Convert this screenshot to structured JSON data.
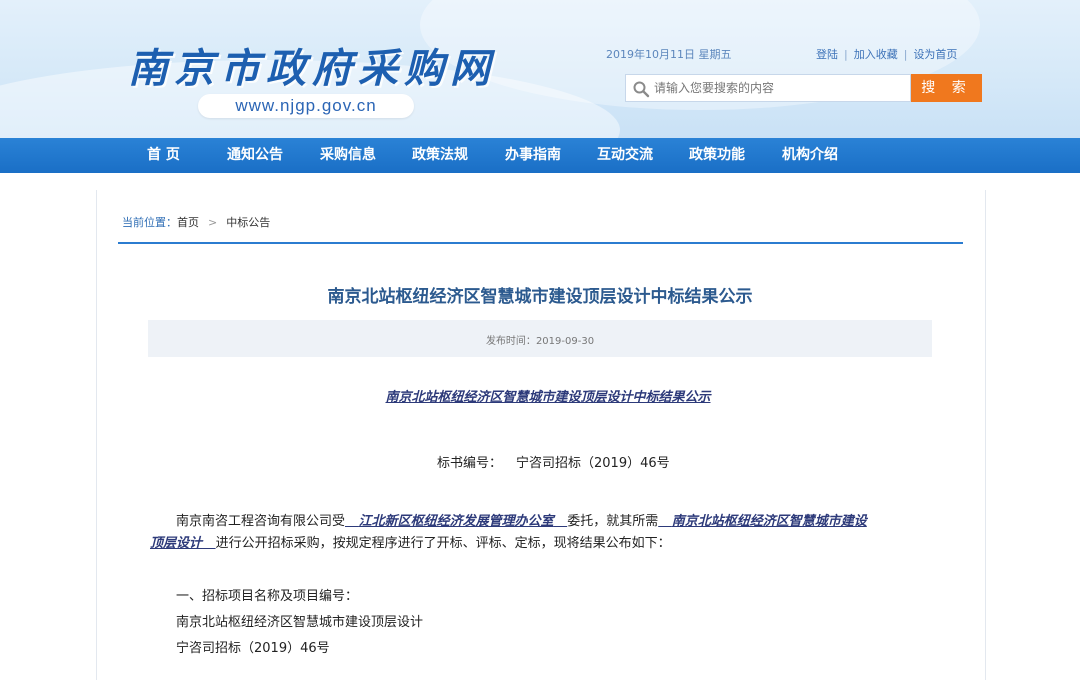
{
  "header": {
    "site_title": "南京市政府采购网",
    "site_url": "www.njgp.gov.cn",
    "date": "2019年10月11日 星期五",
    "links": [
      "登陆",
      "加入收藏",
      "设为首页"
    ],
    "search": {
      "placeholder": "请输入您要搜索的内容",
      "button_label": "搜 索"
    }
  },
  "nav": {
    "items": [
      "首 页",
      "通知公告",
      "采购信息",
      "政策法规",
      "办事指南",
      "互动交流",
      "政策功能",
      "机构介绍"
    ]
  },
  "breadcrumb": {
    "label": "当前位置：",
    "home": "首页",
    "separator": ">",
    "current": "中标公告"
  },
  "article": {
    "title": "南京北站枢纽经济区智慧城市建设顶层设计中标结果公示",
    "publish_label": "发布时间：",
    "publish_date": "2019-09-30",
    "doc_heading": "南京北站枢纽经济区智慧城市建设顶层设计中标结果公示",
    "bid_number_label": "标书编号：",
    "bid_number": "宁咨司招标（2019）46号",
    "intro": {
      "p1": "南京南咨工程咨询有限公司受",
      "client": "江北新区枢纽经济发展管理办公室",
      "p2": "委托，就其所需",
      "project_line1": "南京北站枢纽经济区智慧城市建设",
      "project_line2": "顶层设计",
      "p3": "进行公开招标采购，按规定程序进行了开标、评标、定标，现将结果公布如下："
    },
    "section1_heading": "一、招标项目名称及项目编号：",
    "project_name": "南京北站枢纽经济区智慧城市建设顶层设计",
    "project_number": "宁咨司招标（2019）46号"
  },
  "colors": {
    "nav_bg": "#1a6fc6",
    "search_button": "#f0781e",
    "title_text": "#2c5a8f",
    "accent_rule": "#2b7cd0"
  }
}
